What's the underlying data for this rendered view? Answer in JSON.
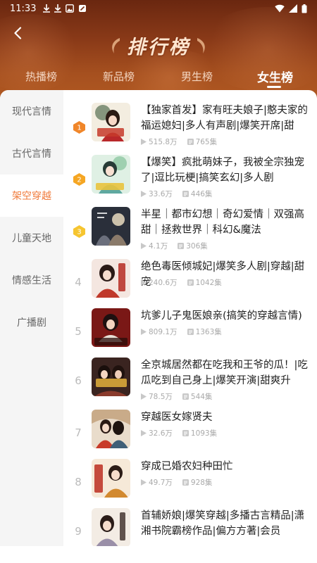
{
  "status_bar": {
    "time": "11:33"
  },
  "header": {
    "title": "排行榜"
  },
  "tabs": [
    {
      "label": "热播榜",
      "active": false
    },
    {
      "label": "新品榜",
      "active": false
    },
    {
      "label": "男生榜",
      "active": false
    },
    {
      "label": "女生榜",
      "active": true
    }
  ],
  "sidebar": {
    "items": [
      {
        "label": "现代言情",
        "active": false
      },
      {
        "label": "古代言情",
        "active": false
      },
      {
        "label": "架空穿越",
        "active": true
      },
      {
        "label": "儿童天地",
        "active": false
      },
      {
        "label": "情感生活",
        "active": false
      },
      {
        "label": "广播剧",
        "active": false
      }
    ]
  },
  "list": {
    "items": [
      {
        "rank": "1",
        "badge": "medal-1",
        "title": "【独家首发】家有旺夫娘子|憨夫家的福运媳妇|多人有声剧|爆笑开席|甜爽...",
        "plays": "515.8万",
        "episodes": "765集"
      },
      {
        "rank": "2",
        "badge": "medal-2",
        "title": "【爆笑】疯批萌妹子，我被全宗独宠了|逗比玩梗|搞笑玄幻|多人剧",
        "plays": "33.6万",
        "episodes": "446集"
      },
      {
        "rank": "3",
        "badge": "medal-3",
        "title": "半星｜都市幻想｜奇幻爱情｜双强高甜｜拯救世界｜科幻&魔法",
        "plays": "4.1万",
        "episodes": "306集"
      },
      {
        "rank": "4",
        "title": "绝色毒医倾城妃|爆笑多人剧|穿越|甜宠",
        "plays": "240.6万",
        "episodes": "1042集"
      },
      {
        "rank": "5",
        "title": "坑爹儿子鬼医娘亲(搞笑的穿越言情)",
        "plays": "809.1万",
        "episodes": "1363集"
      },
      {
        "rank": "6",
        "title": "全京城居然都在吃我和王爷的瓜！|吃瓜吃到自己身上|爆笑开演|甜爽升级|...",
        "plays": "78.5万",
        "episodes": "544集"
      },
      {
        "rank": "7",
        "title": "穿越医女嫁贤夫",
        "plays": "32.6万",
        "episodes": "1093集"
      },
      {
        "rank": "8",
        "title": "穿成已婚农妇种田忙",
        "plays": "49.7万",
        "episodes": "928集"
      },
      {
        "rank": "9",
        "title": "首辅娇娘|爆笑穿越|多播古言精品|潇湘书院霸榜作品|偏方方著|会员",
        "plays": "",
        "episodes": ""
      }
    ]
  },
  "colors": {
    "accent": "#f07a3a",
    "header_top": "#6a2710",
    "header_bottom": "#b25a22",
    "medal_gold_1": "#f0862a",
    "medal_gold_2": "#f5a623",
    "medal_gold_3": "#f6c530"
  },
  "icons": {
    "back": "chevron-left-icon",
    "plays": "play-icon",
    "episodes": "episode-list-icon"
  }
}
